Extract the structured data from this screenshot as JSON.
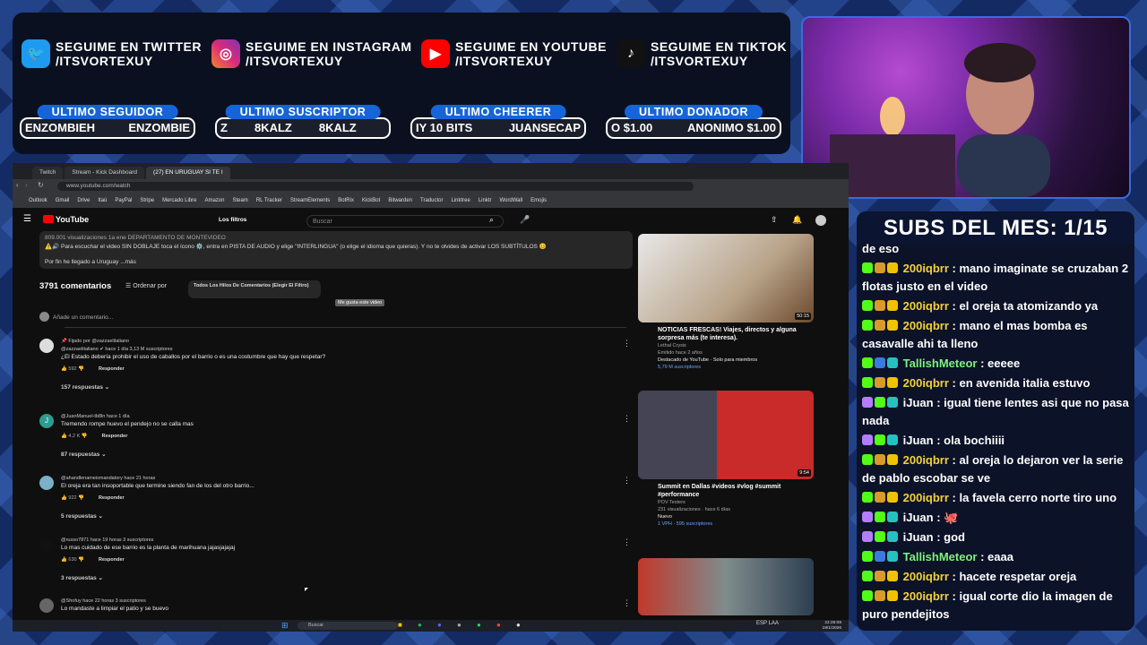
{
  "overlay": {
    "socials": [
      {
        "icon": "twitter-icon",
        "line1": "SEGUIME EN TWITTER",
        "line2": "/ITSVORTEXUY",
        "color": "#1d9bf0"
      },
      {
        "icon": "instagram-icon",
        "line1": "SEGUIME EN INSTAGRAM",
        "line2": "/ITSVORTEXUY",
        "color": "#d6249f"
      },
      {
        "icon": "youtube-icon",
        "line1": "SEGUIME EN YOUTUBE",
        "line2": "/ITSVORTEXUY",
        "color": "#ff0000"
      },
      {
        "icon": "tiktok-icon",
        "line1": "SEGUIME EN TIKTOK",
        "line2": "/ITSVORTEXUY",
        "color": "#111111"
      }
    ],
    "stats": [
      {
        "title": "ULTIMO SEGUIDOR",
        "value_a": "ENZOMBIEH",
        "value_b": "ENZOMBIE"
      },
      {
        "title": "ULTIMO SUSCRIPTOR",
        "value_a": "Z",
        "value_b": "8KALZ",
        "value_c": "8KALZ"
      },
      {
        "title": "ULTIMO CHEERER",
        "value_a": "IY 10 BITS",
        "value_b": "JUANSECAP"
      },
      {
        "title": "ULTIMO DONADOR",
        "value_a": "O $1.00",
        "value_b": "ANONIMO $1.00"
      }
    ]
  },
  "chat": {
    "header": "SUBS DEL MES: 1/15",
    "messages": [
      {
        "user": "",
        "text": "de eso"
      },
      {
        "user": "200iqbrr",
        "text": " : mano imaginate se cruzaban 2 flotas justo en el video"
      },
      {
        "user": "200iqbrr",
        "text": " : el oreja ta atomizando ya"
      },
      {
        "user": "200iqbrr",
        "text": " : mano el mas bomba es casavalle ahi ta lleno"
      },
      {
        "user": "TallishMeteor",
        "text": " : eeeee"
      },
      {
        "user": "200iqbrr",
        "text": " : en avenida italia estuvo"
      },
      {
        "user": "iJuan",
        "text": " : igual tiene lentes asi que no pasa nada"
      },
      {
        "user": "iJuan",
        "text": " : ola bochiiii"
      },
      {
        "user": "200iqbrr",
        "text": " : al oreja lo dejaron ver la serie de pablo escobar se ve"
      },
      {
        "user": "200iqbrr",
        "text": " : la favela cerro norte tiro uno"
      },
      {
        "user": "iJuan",
        "text": " : 🐙"
      },
      {
        "user": "iJuan",
        "text": " : god"
      },
      {
        "user": "TallishMeteor",
        "text": " : eaaa"
      },
      {
        "user": "200iqbrr",
        "text": " : hacete respetar oreja"
      },
      {
        "user": "200iqbrr",
        "text": " : igual corte dio la imagen de puro pendejitos"
      }
    ]
  },
  "browser": {
    "tabs": [
      "Twitch",
      "Stream - Kick Dashboard",
      "(27) EN URUGUAY SI TE I"
    ],
    "url": "www.youtube.com/watch",
    "bookmarks": [
      "Outlook",
      "Gmail",
      "Drive",
      "Itaú",
      "PayPal",
      "Stripe",
      "Mercado Libre",
      "Amazon",
      "Steam",
      "RL Tracker",
      "StreamElements",
      "BotRix",
      "KickBot",
      "Bitwarden",
      "Traductor",
      "Linktree",
      "Linktr",
      "WordWall",
      "Emojis"
    ]
  },
  "youtube": {
    "logo": "YouTube",
    "filters": "Los filtros",
    "search_placeholder": "Buscar",
    "desc_line0": "809.001 visualizaciones  1a ene  DEPARTAMENTO DE MONTEVIDEO",
    "desc_line1": "⚠️🔊 Para escuchar el video SIN DOBLAJE toca el ícono ⚙️, entra en PISTA DE AUDIO y elige \"INTERLINGUA\" (o elige el idioma que quieras). Y no te olvides de activar LOS SUBTÍTULOS 😊",
    "desc_line2": "Por fin he llegado a Uruguay ...más",
    "tooltip": "Me gusta este video",
    "comments_count": "3791 comentarios",
    "sort_label": "Ordenar por",
    "filter_label": "Todos Los Hilos De Comentarios (Elegir El Filtro)",
    "add_comment": "Añade un comentario...",
    "comments": [
      {
        "meta": "📌 Fijado por @zazzaelitaliano",
        "meta2": "@zazzaelitaliano ✔  hace 1 día  3,13 M suscriptores",
        "text": "¿El Estado debería prohibir el uso de caballos por el barrio o es una costumbre que hay que respetar?",
        "likes": "592",
        "reply": "Responder",
        "replies": "157 respuestas"
      },
      {
        "meta": "@JuanManuel-tb8ln  hace 1 día",
        "text": "Tremendo rompe huevo el pendejo no se calla mas",
        "likes": "4,2 K",
        "reply": "Responder",
        "replies": "87 respuestas"
      },
      {
        "meta": "@ahandlenameismandatory  hace 21 horas",
        "text": "El oreja era tan insoportable que termine siendo fan de los del otro barrio...",
        "likes": "922",
        "reply": "Responder",
        "replies": "5 respuestas"
      },
      {
        "meta": "@russo7871  hace 19 horas  3 suscriptores",
        "text": "Lo mas cuidado de ese barrio es la planta de marihuana jajasjajajaj",
        "likes": "630",
        "reply": "Responder",
        "replies": "3 respuestas"
      },
      {
        "meta": "@Shofuy  hace 22 horas  3 suscriptores",
        "text": "Lo mandaste a limpiar el patio y se buevo",
        "likes": "",
        "reply": "",
        "replies": ""
      }
    ],
    "sidebar": [
      {
        "title": "NOTICIAS FRESCAS! Viajes, directos y alguna sorpresa más (te interesa).",
        "channel": "Lethal Crysis",
        "meta": "Emitido hace 2 años",
        "badge": "Destacado de YouTube · Solo para miembros",
        "subs": "5,79 M suscriptores",
        "duration": "50:15"
      },
      {
        "title": "Summit en Dallas #videos #vlog #summit #performance",
        "channel": "POV Testers",
        "meta": "231 visualizaciones · hace 6 días",
        "badge": "Nuevo",
        "subs": "1 VPH · 595 suscriptores",
        "duration": "9:54"
      },
      {
        "title": "",
        "channel": "",
        "meta": "",
        "badge": "",
        "subs": "",
        "duration": ""
      }
    ]
  },
  "taskbar": {
    "search": "Buscar",
    "time": "22:26:08",
    "date": "19/1/2026",
    "lang": "ESP LAA"
  }
}
